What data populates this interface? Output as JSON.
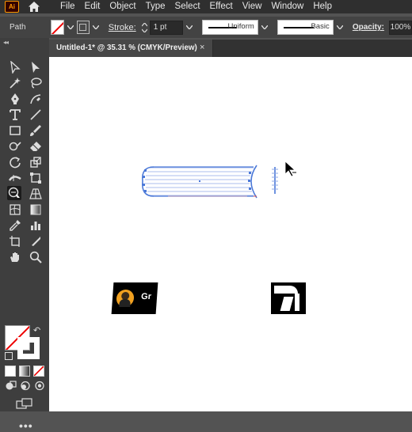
{
  "app": {
    "logo_text": "Ai",
    "menu": [
      "File",
      "Edit",
      "Object",
      "Type",
      "Select",
      "Effect",
      "View",
      "Window",
      "Help"
    ]
  },
  "control_bar": {
    "selection_label": "Path",
    "stroke_label": "Stroke:",
    "stroke_weight": "1 pt",
    "profile_label": "Uniform",
    "brush_label": "Basic",
    "opacity_label": "Opacity:",
    "opacity_value": "100%"
  },
  "document_tab": {
    "title": "Untitled-1* @ 35.31 % (CMYK/Preview)",
    "close_glyph": "×"
  },
  "toolbar": {
    "collapse_glyph": "◂◂",
    "swap_glyph": "↶",
    "more_glyph": "•••"
  },
  "canvas": {
    "thumbnail_left_text": "Gr"
  },
  "colors": {
    "menubar_bg": "#2f2f2f",
    "control_bg": "#434343",
    "toolbar_bg": "#3e3e3e",
    "accent_logo": "#ff9a00",
    "selection_blue": "#4a78d8"
  }
}
